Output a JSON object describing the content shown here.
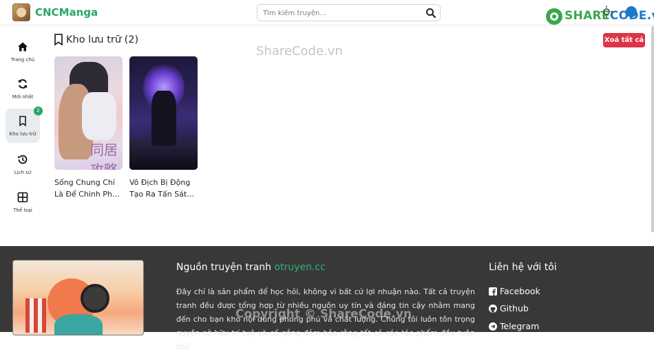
{
  "header": {
    "brand": "CNCManga",
    "search_placeholder": "Tìm kiếm truyện...",
    "sharecode_part1": "SHARE",
    "sharecode_part2": "CODE.vn"
  },
  "sidebar": {
    "items": [
      {
        "label": "Trang chủ",
        "icon": "home-icon"
      },
      {
        "label": "Mới nhất",
        "icon": "refresh-icon"
      },
      {
        "label": "Kho lưu trữ",
        "icon": "bookmark-icon",
        "badge": "2"
      },
      {
        "label": "Lịch sử",
        "icon": "history-icon"
      },
      {
        "label": "Thể loại",
        "icon": "grid-icon"
      }
    ]
  },
  "main": {
    "title": "Kho lưu trữ (2)",
    "clear_all": "Xoá tất cả",
    "watermark": "ShareCode.vn",
    "cards": [
      {
        "line1": "Sống Chung Chỉ",
        "line2": "Là Để Chinh Phụ…",
        "cover_text": "同居攻略"
      },
      {
        "line1": "Vô Địch Bị Động",
        "line2": "Tạo Ra Tấn Sát…"
      }
    ]
  },
  "footer": {
    "heading_prefix": "Nguồn truyện tranh ",
    "heading_accent": "otruyen.cc",
    "description": "Đây chỉ là sản phẩm để học hỏi, không vì bất cứ lợi nhuận nào. Tất cả truyện tranh đều được tổng hợp từ nhiều nguồn uy tín và đáng tin cậy nhằm mang đến cho bạn kho nội dung phong phú và chất lượng. Chúng tôi luôn tôn trọng quyền sở hữu trí tuệ và cố gắng đảm bảo rằng tất cả các tác phẩm đều tuân thủ",
    "contact_heading": "Liên hệ với tôi",
    "contacts": [
      {
        "label": "Facebook",
        "icon": "facebook-icon"
      },
      {
        "label": "Github",
        "icon": "github-icon"
      },
      {
        "label": "Telegram",
        "icon": "telegram-icon"
      }
    ],
    "copyright": "Copyright © ShareCode.vn"
  },
  "colors": {
    "brand": "#2aa56a",
    "danger": "#dc3545",
    "footer_bg": "#383838"
  }
}
